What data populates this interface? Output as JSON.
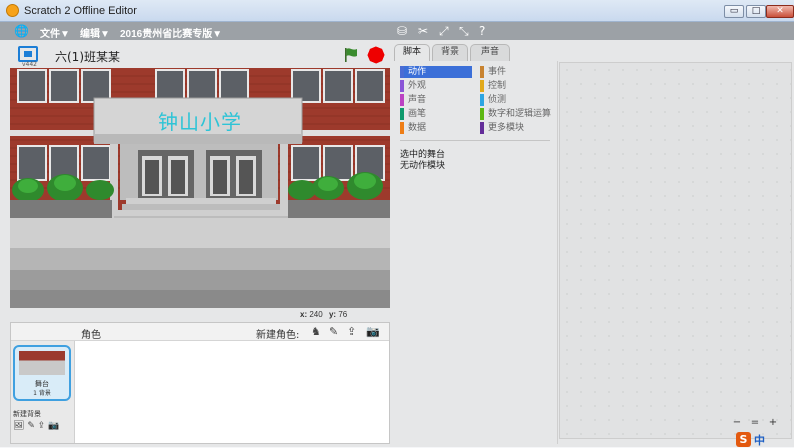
{
  "window": {
    "title": "Scratch 2 Offline Editor",
    "minimize_label": "▭",
    "maximize_label": "□",
    "close_label": "✕"
  },
  "menubar": {
    "globe_icon": "globe-icon",
    "file_label": "文件▼",
    "edit_label": "编辑▼",
    "project_label": "2016贵州省比赛专版▼",
    "tools": [
      "duplicate-icon",
      "delete-icon",
      "grow-icon",
      "shrink-icon",
      "help-icon"
    ]
  },
  "stage_header": {
    "version": "v442",
    "project_name": "六(1)班某某"
  },
  "stage": {
    "school_name": "钟山小学"
  },
  "coords": {
    "x_label": "x:",
    "x_value": "240",
    "y_label": "y:",
    "y_value": "76"
  },
  "sprite_panel": {
    "sprites_label": "角色",
    "new_sprite_label": "新建角色:",
    "stage_thumb_name": "舞台",
    "stage_thumb_count": "1 背景",
    "new_backdrop_label": "新建背景"
  },
  "tabs": [
    "脚本",
    "背景",
    "声音"
  ],
  "palette": {
    "categories_left": [
      {
        "label": "动作",
        "color": "#4a6cd4"
      },
      {
        "label": "外观",
        "color": "#8a55d7"
      },
      {
        "label": "声音",
        "color": "#bb42c3"
      },
      {
        "label": "画笔",
        "color": "#0e9a6c"
      },
      {
        "label": "数据",
        "color": "#ee7d16"
      }
    ],
    "categories_right": [
      {
        "label": "事件",
        "color": "#c88330"
      },
      {
        "label": "控制",
        "color": "#e1a91a"
      },
      {
        "label": "侦测",
        "color": "#2ca5e2"
      },
      {
        "label": "数字和逻辑运算",
        "color": "#5cb712"
      },
      {
        "label": "更多模块",
        "color": "#632d99"
      }
    ],
    "selected_stage": "选中的舞台",
    "no_motion_blocks": "无动作模块"
  },
  "zoom": {
    "zoom_out": "−",
    "zoom_reset": "=",
    "zoom_in": "+"
  },
  "brand": {
    "logo": "S",
    "text": "中"
  },
  "colors": {
    "accent": "#4a6cd4",
    "menubar": "#9ca1a6",
    "stop": "#e00000",
    "flag": "#3a8b2e"
  }
}
